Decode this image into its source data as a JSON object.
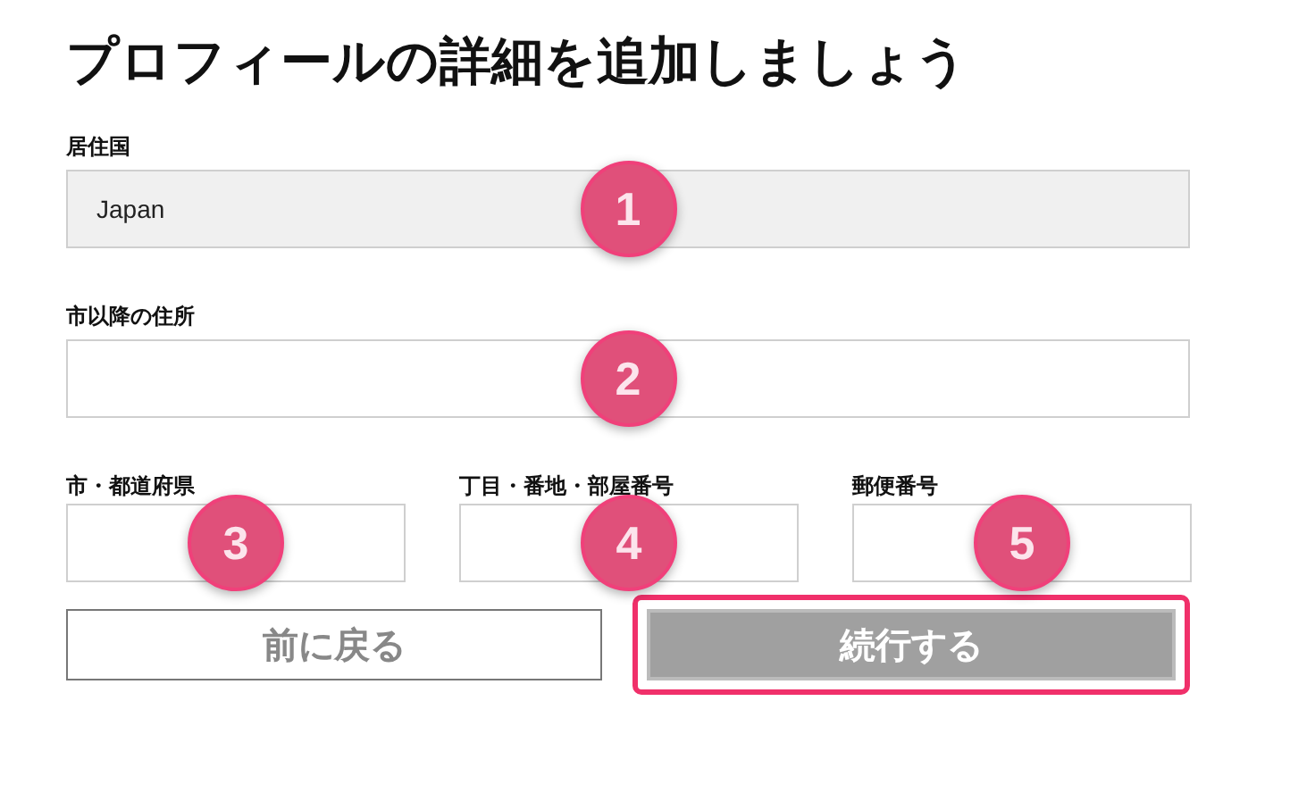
{
  "title": "プロフィールの詳細を追加しましょう",
  "fields": [
    {
      "label": "居住国",
      "value": "Japan",
      "disabled": true,
      "badge": "1"
    },
    {
      "label": "市以降の住所",
      "disabled": false,
      "badge": "2"
    }
  ],
  "row_fields": [
    {
      "label": "市・都道府県",
      "disabled": false,
      "badge": "3"
    },
    {
      "label": "丁目・番地・部屋番号",
      "disabled": false,
      "badge": "4"
    },
    {
      "label": "郵便番号",
      "disabled": false,
      "badge": "5"
    }
  ],
  "buttons": [
    {
      "label": "前に戻る",
      "kind": "secondary",
      "disabled": false,
      "highlighted": false
    },
    {
      "label": "続行する",
      "kind": "primary",
      "disabled": true,
      "highlighted": true
    }
  ]
}
